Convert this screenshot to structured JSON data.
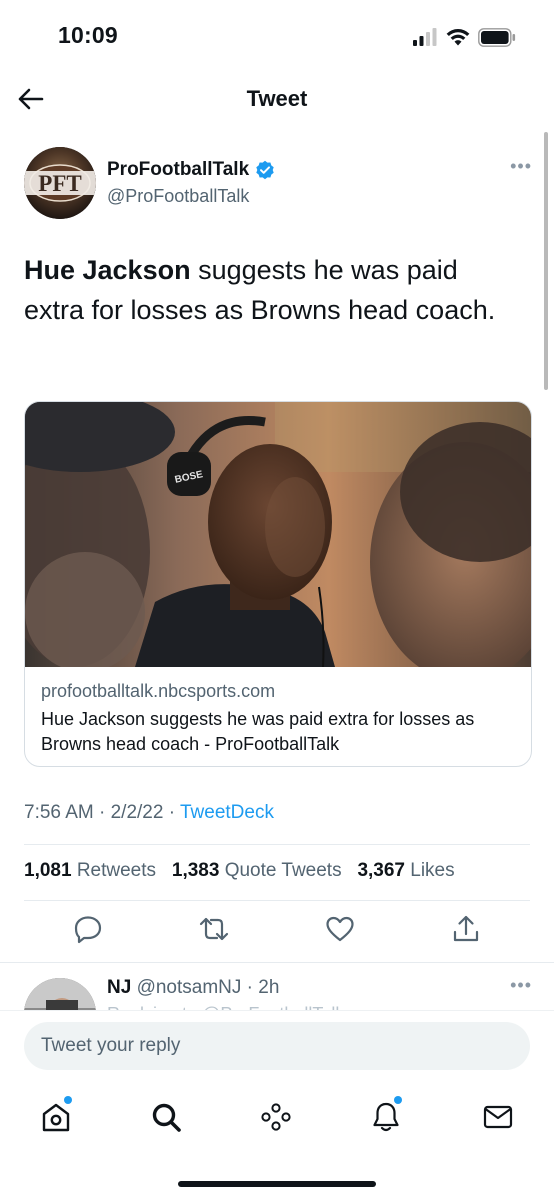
{
  "status_bar": {
    "time": "10:09"
  },
  "header": {
    "title": "Tweet"
  },
  "author": {
    "name": "ProFootballTalk",
    "handle": "@ProFootballTalk",
    "avatar_text": "PFT"
  },
  "tweet": {
    "text_bold": "Hue Jackson",
    "text_rest": " suggests he was paid extra for losses as Browns head coach."
  },
  "card": {
    "image_badge": "BOSE",
    "domain": "profootballtalk.nbcsports.com",
    "title": "Hue Jackson suggests he was paid extra for losses as Browns head coach - ProFootballTalk"
  },
  "meta": {
    "time": "7:56 AM",
    "date": "2/2/22",
    "source": "TweetDeck",
    "separator": " · "
  },
  "stats": {
    "retweets_count": "1,081",
    "retweets_label": "Retweets",
    "quotes_count": "1,383",
    "quotes_label": "Quote Tweets",
    "likes_count": "3,367",
    "likes_label": "Likes"
  },
  "reply_preview": {
    "name": "NJ",
    "handle": "@notsamNJ",
    "age": "2h",
    "peek_text": "Replying to @ProFootballTalk"
  },
  "composer": {
    "placeholder": "Tweet your reply"
  },
  "icons": {
    "back": "arrow-left-icon",
    "verified": "verified-badge-icon",
    "more": "more-dots-icon",
    "reply": "reply-icon",
    "retweet": "retweet-icon",
    "like": "heart-icon",
    "share": "share-icon",
    "home": "home-icon",
    "search": "search-icon",
    "spaces": "spaces-icon",
    "notifications": "bell-icon",
    "messages": "mail-icon"
  },
  "colors": {
    "accent": "#1d9bf0",
    "text": "#0f1419",
    "secondary": "#536471"
  }
}
